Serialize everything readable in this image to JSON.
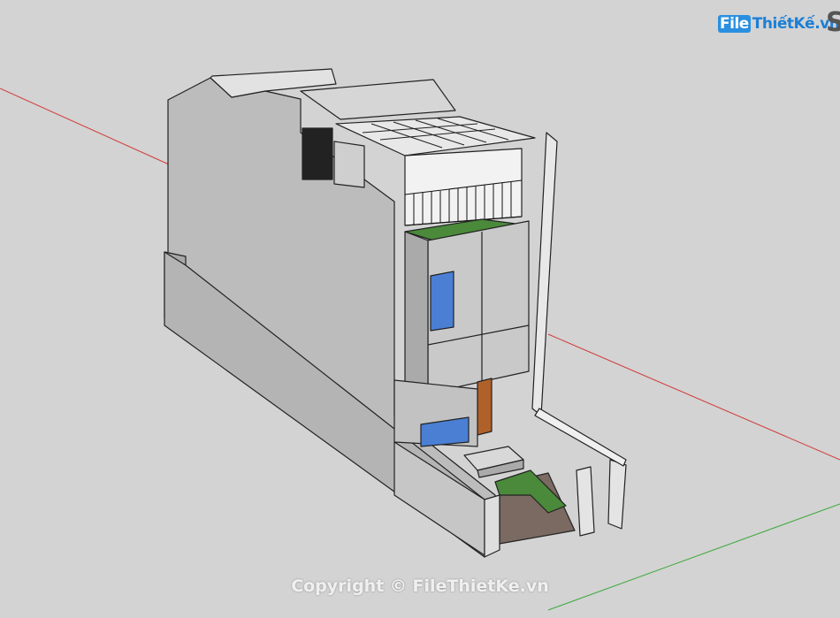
{
  "scene": {
    "background_color": "#d3d3d3",
    "red_axis_color": "#d23a3a",
    "green_axis_color": "#3aa83a",
    "wall_color": "#bdbdbd",
    "wall_dark_color": "#9e9e9e",
    "glass_color": "#4a7fd4",
    "grass_color": "#4a8a3a",
    "wood_color": "#b0612a",
    "paving_color": "#7a6a62"
  },
  "branding": {
    "logo_text_file": "File",
    "logo_text_rest": "ThiếtKế",
    "logo_domain": ".vn",
    "badge_text": "◉",
    "app_initial": "S"
  },
  "watermark": {
    "text": "Copyright © FileThietKe.vn"
  }
}
